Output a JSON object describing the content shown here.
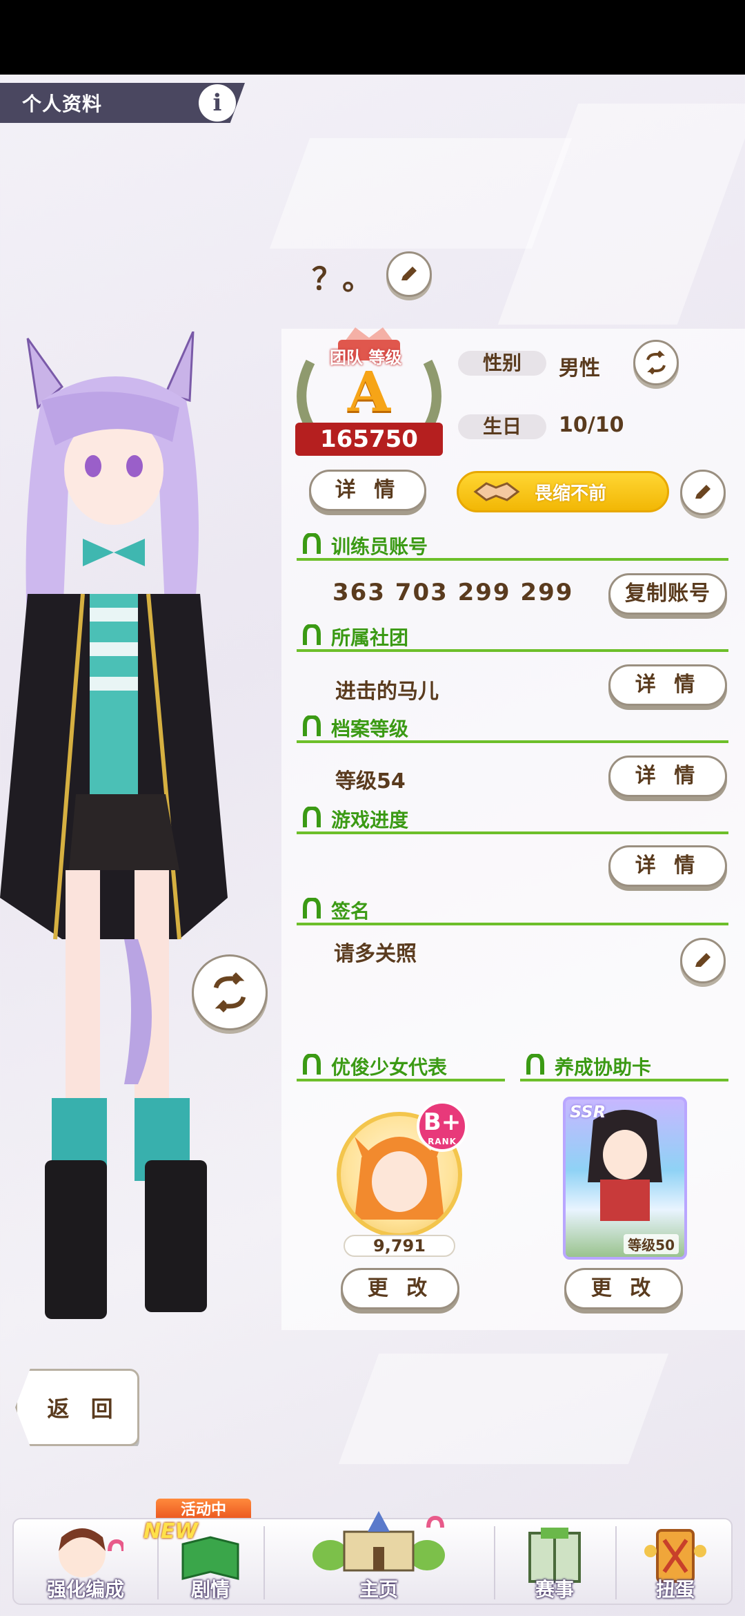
{
  "header": {
    "title": "个人资料",
    "info_icon": "i"
  },
  "profile": {
    "name": "？。",
    "team_rank": {
      "title": "团队 等级",
      "grade": "A",
      "score": "165750"
    },
    "gender_label": "性别",
    "gender_value": "男性",
    "birthday_label": "生日",
    "birthday_value": "10/10",
    "details_label": "详 情",
    "title_badge": "畏缩不前"
  },
  "sections": {
    "trainer_id": {
      "label": "训练员账号",
      "value": "363 703 299 299",
      "action": "复制账号"
    },
    "club": {
      "label": "所属社团",
      "value": "进击的马儿",
      "action": "详 情"
    },
    "archive_level": {
      "label": "档案等级",
      "value": "等级54",
      "action": "详 情"
    },
    "game_progress": {
      "label": "游戏进度",
      "value": "",
      "action": "详 情"
    },
    "signature": {
      "label": "签名",
      "value": "请多关照"
    }
  },
  "representative": {
    "label": "优俊少女代表",
    "rank": "B+",
    "rank_sub": "RANK",
    "fans": "9,791",
    "change": "更 改"
  },
  "support_card": {
    "label": "养成协助卡",
    "rarity": "SSR",
    "level": "等级50",
    "change": "更 改"
  },
  "back_label": "返 回",
  "nav": {
    "event_tag": "活动中",
    "new_tag": "NEW",
    "items": [
      {
        "label": "强化编成"
      },
      {
        "label": "剧情"
      },
      {
        "label": "主页"
      },
      {
        "label": "赛事"
      },
      {
        "label": "扭蛋"
      }
    ]
  },
  "colors": {
    "accent_green": "#3b9a14",
    "text_brown": "#5a3b1e",
    "title_gold": "#f2b705",
    "rank_red": "#b51f1f"
  }
}
